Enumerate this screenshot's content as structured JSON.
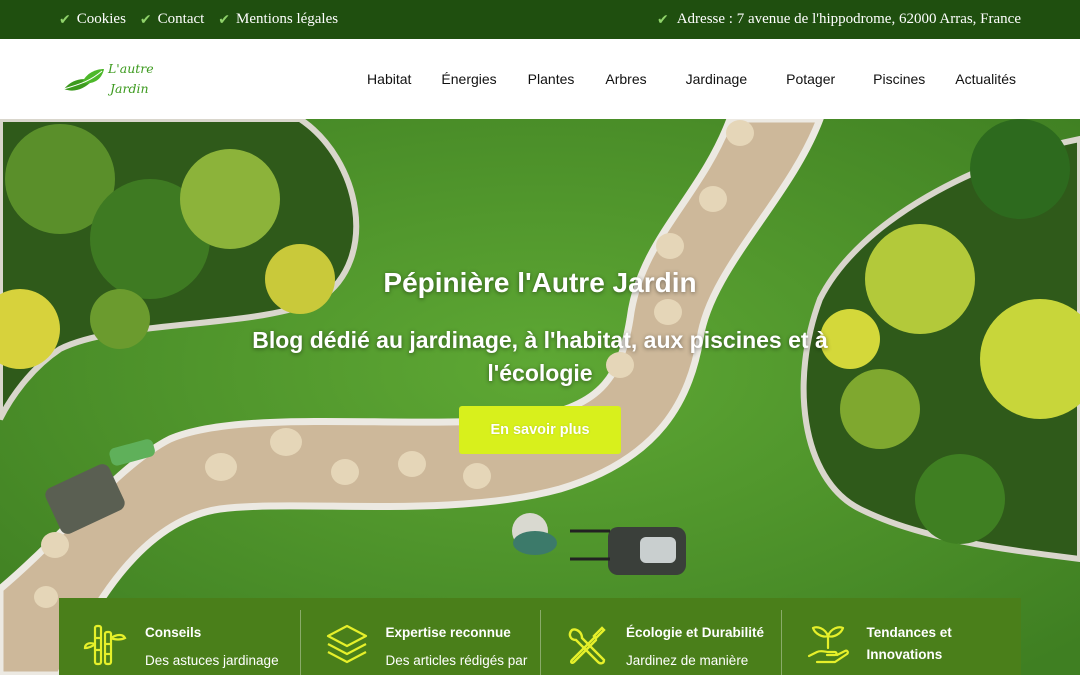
{
  "topbar": {
    "links": [
      {
        "label": "Cookies"
      },
      {
        "label": "Contact"
      },
      {
        "label": "Mentions légales"
      }
    ],
    "address": "Adresse : 7 avenue de l'hippodrome, 62000 Arras, France"
  },
  "logo": {
    "line1": "L'autre",
    "line2": "Jardin"
  },
  "nav": {
    "items": [
      {
        "label": "Habitat"
      },
      {
        "label": "Énergies"
      },
      {
        "label": "Plantes"
      },
      {
        "label": "Arbres"
      },
      {
        "label": "Jardinage"
      },
      {
        "label": "Potager"
      },
      {
        "label": "Piscines"
      },
      {
        "label": "Actualités"
      }
    ]
  },
  "hero": {
    "title": "Pépinière l'Autre Jardin",
    "subtitle": "Blog dédié au jardinage, à l'habitat, aux piscines et à l'écologie",
    "cta_label": "En savoir plus"
  },
  "features": [
    {
      "icon": "bamboo-icon",
      "title": "Conseils",
      "text": "Des astuces jardinage"
    },
    {
      "icon": "layers-icon",
      "title": "Expertise reconnue",
      "text": "Des articles rédigés par"
    },
    {
      "icon": "tools-icon",
      "title": "Écologie et Durabilité",
      "text": "Jardinez de manière"
    },
    {
      "icon": "plant-hand-icon",
      "title": "Tendances et Innovations",
      "text": ""
    }
  ],
  "colors": {
    "topbar_bg": "#1f4f0f",
    "accent_green": "#3c9a1e",
    "cta_yellow": "#d8f01c",
    "features_bg": "#4a7f1a"
  }
}
